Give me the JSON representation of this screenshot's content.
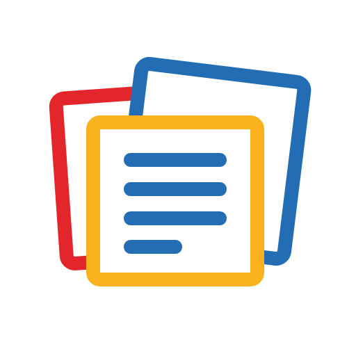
{
  "icon": {
    "name": "notebook-app-icon",
    "colors": {
      "background": "#ffffff",
      "back_card": "#e3262b",
      "middle_card": "#226db4",
      "front_card": "#f9b21d",
      "text_lines": "#226db4",
      "card_fill": "#ffffff"
    },
    "text_line_count": 4
  }
}
